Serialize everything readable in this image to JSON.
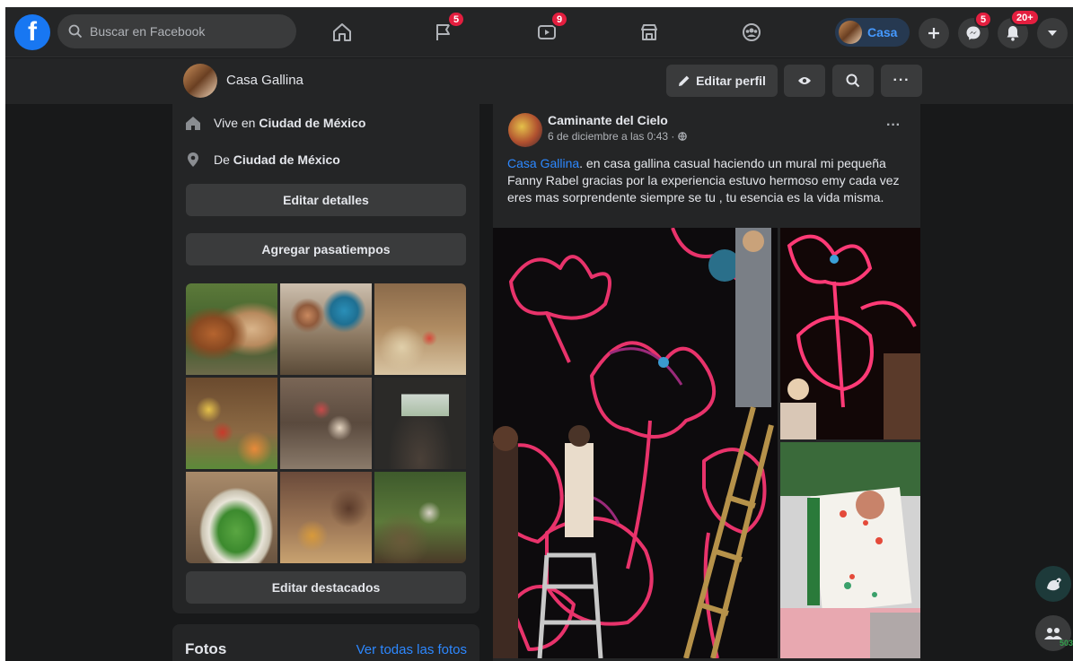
{
  "nav": {
    "search_placeholder": "Buscar en Facebook",
    "badges": {
      "pages": "5",
      "watch": "9",
      "messenger": "5",
      "notifications": "20+"
    },
    "profile_name": "Casa"
  },
  "subbar": {
    "profile_name": "Casa Gallina",
    "edit_profile_label": "Editar perfil"
  },
  "intro": {
    "lives_prefix": "Vive en ",
    "lives_city": "Ciudad de México",
    "from_prefix": "De ",
    "from_city": "Ciudad de México",
    "edit_details_label": "Editar detalles",
    "add_hobbies_label": "Agregar pasatiempos",
    "edit_featured_label": "Editar destacados"
  },
  "photos": {
    "title": "Fotos",
    "see_all_label": "Ver todas las fotos"
  },
  "post": {
    "author": "Caminante del Cielo",
    "date": "6 de diciembre a las 0:43 · ",
    "mention": "Casa Gallina",
    "text": ".  en casa gallina casual haciendo un mural mi pequeña Fanny Rabel gracias por la experiencia estuvo hermoso emy cada vez eres mas sorprendente siempre se tu , tu esencia es la vida misma.",
    "more_label": "···"
  },
  "contacts": {
    "count": "503"
  },
  "colors": {
    "accent": "#1877f2",
    "link": "#2d88ff",
    "badge": "#e41e3f",
    "bg": "#18191a",
    "card": "#242526"
  }
}
